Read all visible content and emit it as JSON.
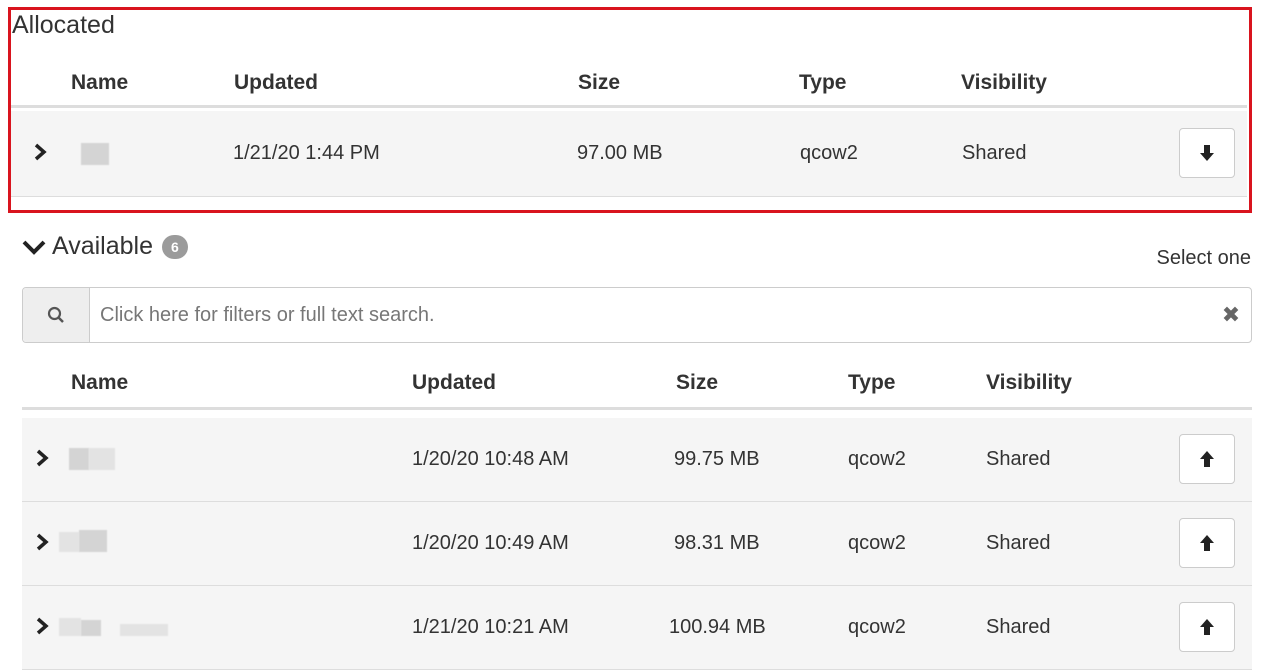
{
  "allocated": {
    "title": "Allocated",
    "columns": [
      "Name",
      "Updated",
      "Size",
      "Type",
      "Visibility"
    ],
    "rows": [
      {
        "updated": "1/21/20 1:44 PM",
        "size": "97.00 MB",
        "type": "qcow2",
        "visibility": "Shared",
        "action_icon": "arrow-down-icon"
      }
    ],
    "highlight_color": "#d9141e"
  },
  "available": {
    "title": "Available",
    "count": "6",
    "select_hint": "Select one",
    "search": {
      "placeholder": "Click here for filters or full text search.",
      "value": "",
      "clear_icon": "close-icon",
      "search_icon": "search-icon"
    },
    "columns": [
      "Name",
      "Updated",
      "Size",
      "Type",
      "Visibility"
    ],
    "rows": [
      {
        "updated": "1/20/20 10:48 AM",
        "size": "99.75 MB",
        "type": "qcow2",
        "visibility": "Shared",
        "action_icon": "arrow-up-icon"
      },
      {
        "updated": "1/20/20 10:49 AM",
        "size": "98.31 MB",
        "type": "qcow2",
        "visibility": "Shared",
        "action_icon": "arrow-up-icon"
      },
      {
        "updated": "1/21/20 10:21 AM",
        "size": "100.94 MB",
        "type": "qcow2",
        "visibility": "Shared",
        "action_icon": "arrow-up-icon"
      }
    ]
  }
}
